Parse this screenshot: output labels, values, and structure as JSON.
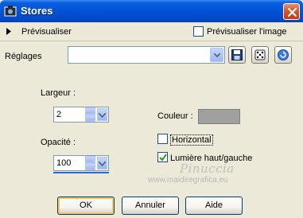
{
  "window": {
    "title": "Stores",
    "close_icon": "close-icon"
  },
  "preview": {
    "expand_label": "Prévisualiser",
    "preview_image_label": "Prévisualiser l'image",
    "preview_image_checked": false
  },
  "settings": {
    "label": "Réglages",
    "preset_value": ""
  },
  "params": {
    "width_label": "Largeur :",
    "width_value": "2",
    "opacity_label": "Opacité :",
    "opacity_value": "100",
    "color_label": "Couleur :",
    "color_value": "#a0a0a0",
    "horizontal_label": "Horizontal",
    "horizontal_checked": false,
    "light_label": "Lumière haut/gauche",
    "light_checked": true
  },
  "watermark": {
    "line1": "Pinuccia",
    "line2": "www.maidiregrafica.eu"
  },
  "buttons": {
    "ok": "OK",
    "cancel": "Annuler",
    "help": "Aide"
  }
}
